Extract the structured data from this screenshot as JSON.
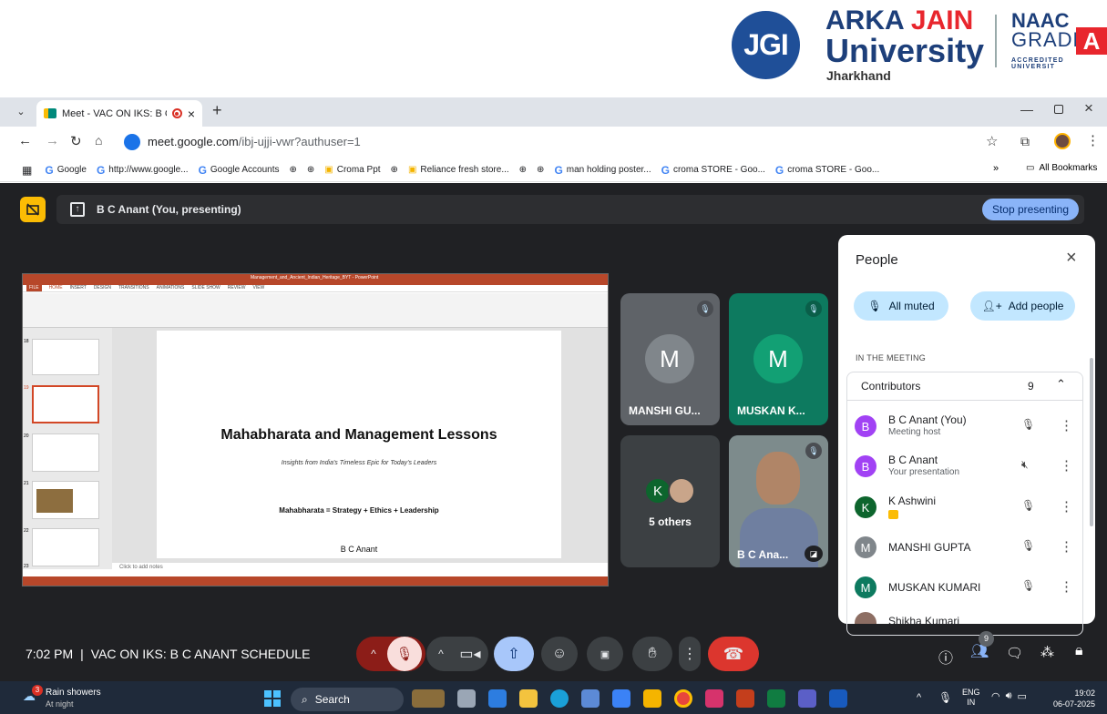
{
  "banner": {
    "jgi": "JGI",
    "name_a": "ARKA ",
    "name_b": "JAIN",
    "university": "University",
    "state": "Jharkhand",
    "naac": "NAAC",
    "grade": "GRADE",
    "grade_letter": "A",
    "accredited": "ACCREDITED UNIVERSIT"
  },
  "browser": {
    "tab_title": "Meet - VAC ON IKS: B C AN",
    "url_host": "meet.google.com",
    "url_path": "/ibj-ujji-vwr?authuser=1",
    "bookmarks": [
      "Google",
      "http://www.google...",
      "Google Accounts",
      "Croma Ppt",
      "Reliance fresh store...",
      "man holding poster...",
      "croma STORE - Goo...",
      "croma STORE - Goo..."
    ],
    "all_bookmarks": "All Bookmarks",
    "more": "»"
  },
  "meet": {
    "presenting_label": "B C Anant (You, presenting)",
    "stop_presenting": "Stop presenting",
    "slide": {
      "title": "Mahabharata and Management Lessons",
      "subtitle": "Insights from India's Timeless Epic for Today's Leaders",
      "formula": "Mahabharata = Strategy + Ethics + Leadership",
      "author": "B C Anant",
      "notes": "Click to add notes",
      "thumb_numbers": [
        "18",
        "19",
        "20",
        "21",
        "22",
        "23"
      ],
      "file_title": "Management_and_Ancient_Indian_Heritage_BYT - PowerPoint",
      "ribbon_tabs": [
        "FILE",
        "HOME",
        "INSERT",
        "DESIGN",
        "TRANSITIONS",
        "ANIMATIONS",
        "SLIDE SHOW",
        "REVIEW",
        "VIEW"
      ]
    },
    "tiles": [
      {
        "letter": "M",
        "name": "MANSHI GU...",
        "color": "#5f6368"
      },
      {
        "letter": "M",
        "name": "MUSKAN K...",
        "color": "#0d7a5f"
      }
    ],
    "others": {
      "letter": "K",
      "label": "5 others"
    },
    "self_tile": {
      "name": "B C Ana..."
    },
    "time": "7:02 PM",
    "divider": "|",
    "meeting_name": "VAC ON IKS: B C ANANT SCHEDULE",
    "people_badge": "9"
  },
  "people_panel": {
    "title": "People",
    "all_muted": "All muted",
    "add_people": "Add people",
    "in_meeting": "IN THE MEETING",
    "contributors": "Contributors",
    "count": "9",
    "members": [
      {
        "letter": "B",
        "name": "B C Anant (You)",
        "sub": "Meeting host",
        "color": "#a142f4"
      },
      {
        "letter": "B",
        "name": "B C Anant",
        "sub": "Your presentation",
        "color": "#a142f4"
      },
      {
        "letter": "K",
        "name": "K Ashwini",
        "sub": "",
        "color": "#0d652d"
      },
      {
        "letter": "M",
        "name": "MANSHI GUPTA",
        "sub": "",
        "color": "#5f6368"
      },
      {
        "letter": "M",
        "name": "MUSKAN KUMARI",
        "sub": "",
        "color": "#0d7a5f"
      },
      {
        "letter": "",
        "name": "Shikha Kumari",
        "sub": "",
        "color": "#8d6e63"
      }
    ]
  },
  "taskbar": {
    "weather_badge": "3",
    "weather": "Rain showers",
    "weather_sub": "At night",
    "search": "Search",
    "lang": "ENG",
    "lang2": "IN",
    "clock": "19:02",
    "date": "06-07-2025"
  }
}
